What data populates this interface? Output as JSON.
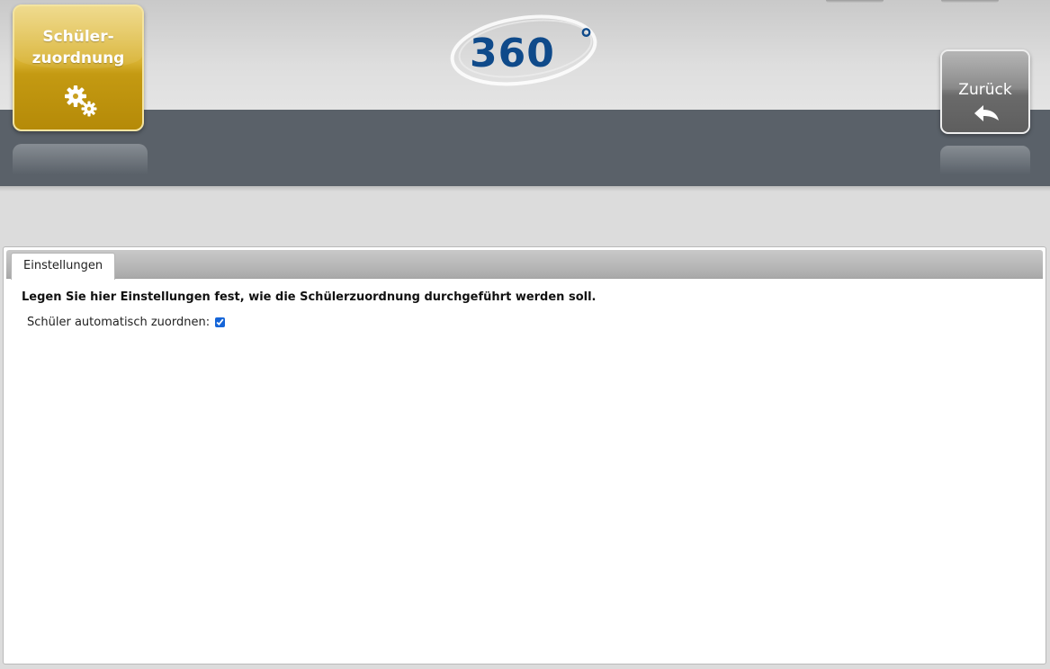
{
  "module_tile": {
    "label_line1": "Schüler-",
    "label_line2": "zuordnung",
    "icon": "gears-icon"
  },
  "logo": {
    "text": "360",
    "degree": "°",
    "color": "#0f4a8a"
  },
  "back_button": {
    "label": "Zurück",
    "icon": "arrow-back-icon"
  },
  "panel": {
    "tabs": [
      {
        "label": "Einstellungen",
        "active": true
      }
    ],
    "heading": "Legen Sie hier Einstellungen fest, wie die Schülerzuordnung durchgeführt werden soll.",
    "option": {
      "label": "Schüler automatisch zuordnen:",
      "checked": true
    }
  },
  "colors": {
    "module_gold": "#d8b231",
    "header_band": "#5a6169",
    "accent_blue": "#1565d8"
  }
}
